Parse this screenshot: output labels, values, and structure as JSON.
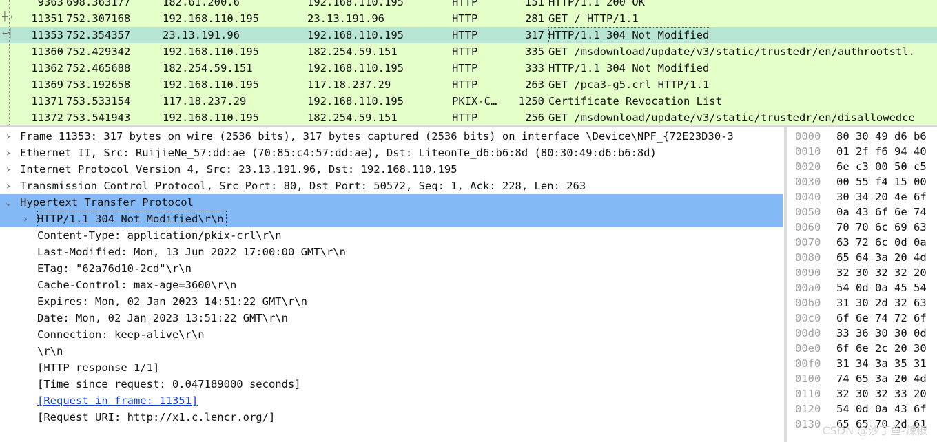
{
  "packet_list": {
    "rows": [
      {
        "no": "9363",
        "time": "698.363177",
        "src": "182.61.200.6",
        "dst": "192.168.110.195",
        "proto": "HTTP",
        "len": "151",
        "info": "HTTP/1.1 200 OK"
      },
      {
        "no": "11351",
        "time": "752.307168",
        "src": "192.168.110.195",
        "dst": "23.13.191.96",
        "proto": "HTTP",
        "len": "281",
        "info": "GET / HTTP/1.1"
      },
      {
        "no": "11353",
        "time": "752.354357",
        "src": "23.13.191.96",
        "dst": "192.168.110.195",
        "proto": "HTTP",
        "len": "317",
        "info": "HTTP/1.1 304 Not Modified"
      },
      {
        "no": "11360",
        "time": "752.429342",
        "src": "192.168.110.195",
        "dst": "182.254.59.151",
        "proto": "HTTP",
        "len": "335",
        "info": "GET /msdownload/update/v3/static/trustedr/en/authrootstl."
      },
      {
        "no": "11362",
        "time": "752.465688",
        "src": "182.254.59.151",
        "dst": "192.168.110.195",
        "proto": "HTTP",
        "len": "333",
        "info": "HTTP/1.1 304 Not Modified"
      },
      {
        "no": "11369",
        "time": "753.192658",
        "src": "192.168.110.195",
        "dst": "117.18.237.29",
        "proto": "HTTP",
        "len": "263",
        "info": "GET /pca3-g5.crl HTTP/1.1"
      },
      {
        "no": "11371",
        "time": "753.533154",
        "src": "117.18.237.29",
        "dst": "192.168.110.195",
        "proto": "PKIX-C…",
        "len": "1250",
        "info": "Certificate Revocation List"
      },
      {
        "no": "11372",
        "time": "753.541943",
        "src": "192.168.110.195",
        "dst": "182.254.59.151",
        "proto": "HTTP",
        "len": "256",
        "info": "GET /msdownload/update/v3/static/trustedr/en/disallowedce"
      }
    ]
  },
  "details": {
    "frame": "Frame 11353: 317 bytes on wire (2536 bits), 317 bytes captured (2536 bits) on interface \\Device\\NPF_{72E23D30-3",
    "ethernet": "Ethernet II, Src: RuijieNe_57:dd:ae (70:85:c4:57:dd:ae), Dst: LiteonTe_d6:b6:8d (80:30:49:d6:b6:8d)",
    "ip": "Internet Protocol Version 4, Src: 23.13.191.96, Dst: 192.168.110.195",
    "tcp": "Transmission Control Protocol, Src Port: 80, Dst Port: 50572, Seq: 1, Ack: 228, Len: 263",
    "http": "Hypertext Transfer Protocol",
    "status_line": "HTTP/1.1 304 Not Modified\\r\\n",
    "content_type": "Content-Type: application/pkix-crl\\r\\n",
    "last_modified": "Last-Modified: Mon, 13 Jun 2022 17:00:00 GMT\\r\\n",
    "etag": "ETag: \"62a76d10-2cd\"\\r\\n",
    "cache_control": "Cache-Control: max-age=3600\\r\\n",
    "expires": "Expires: Mon, 02 Jan 2023 14:51:22 GMT\\r\\n",
    "date": "Date: Mon, 02 Jan 2023 13:51:22 GMT\\r\\n",
    "connection": "Connection: keep-alive\\r\\n",
    "crlf": "\\r\\n",
    "response_count": "[HTTP response 1/1]",
    "time_since": "[Time since request: 0.047189000 seconds]",
    "request_frame": "[Request in frame: 11351]",
    "request_uri": "[Request URI: http://x1.c.lencr.org/]"
  },
  "bytes_pane": {
    "rows": [
      {
        "offset": "0000",
        "hex": "80 30 49 d6 b6"
      },
      {
        "offset": "0010",
        "hex": "01 2f f6 94 40"
      },
      {
        "offset": "0020",
        "hex": "6e c3 00 50 c5"
      },
      {
        "offset": "0030",
        "hex": "00 55 f4 15 00"
      },
      {
        "offset": "0040",
        "hex": "30 34 20 4e 6f"
      },
      {
        "offset": "0050",
        "hex": "0a 43 6f 6e 74"
      },
      {
        "offset": "0060",
        "hex": "70 70 6c 69 63"
      },
      {
        "offset": "0070",
        "hex": "63 72 6c 0d 0a"
      },
      {
        "offset": "0080",
        "hex": "65 64 3a 20 4d"
      },
      {
        "offset": "0090",
        "hex": "32 30 32 32 20"
      },
      {
        "offset": "00a0",
        "hex": "54 0d 0a 45 54"
      },
      {
        "offset": "00b0",
        "hex": "31 30 2d 32 63"
      },
      {
        "offset": "00c0",
        "hex": "6f 6e 74 72 6f"
      },
      {
        "offset": "00d0",
        "hex": "33 36 30 30 0d"
      },
      {
        "offset": "00e0",
        "hex": "6f 6e 2c 20 30"
      },
      {
        "offset": "00f0",
        "hex": "31 34 3a 35 31"
      },
      {
        "offset": "0100",
        "hex": "74 65 3a 20 4d"
      },
      {
        "offset": "0110",
        "hex": "32 30 32 33 20"
      },
      {
        "offset": "0120",
        "hex": "54 0d 0a 43 6f"
      },
      {
        "offset": "0130",
        "hex": "65 65 70 2d 61"
      }
    ]
  },
  "watermark": "CSDN @沙丁鱼-辣椒",
  "colors": {
    "packet_bg": "#e4ffc7",
    "selected_packet_bg": "#b8e6d4",
    "detail_highlight": "#83b9f5",
    "link": "#1a3fd6"
  }
}
